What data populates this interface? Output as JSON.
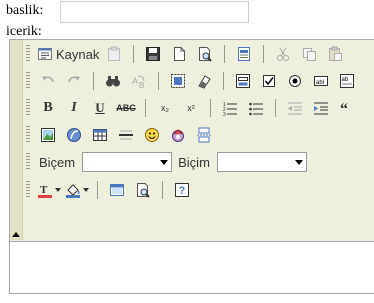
{
  "form": {
    "baslik_label": "baslik:",
    "baslik_value": "",
    "icerik_label": "icerik:"
  },
  "editor": {
    "toolbar": {
      "source_label": "Kaynak",
      "style_combo_label": "Biçem",
      "format_combo_label": "Biçim",
      "style_combo_value": "",
      "format_combo_value": "",
      "bold_label": "B",
      "italic_label": "I",
      "underline_label": "U",
      "strike_label": "ABC",
      "subscript_label": "x₂",
      "superscript_label": "x²",
      "find_glyph": "🔍"
    },
    "content_value": ""
  },
  "colors": {
    "toolbar_bg": "#efefde",
    "border": "#a8a8a8",
    "content_bg": "#ffffff"
  }
}
